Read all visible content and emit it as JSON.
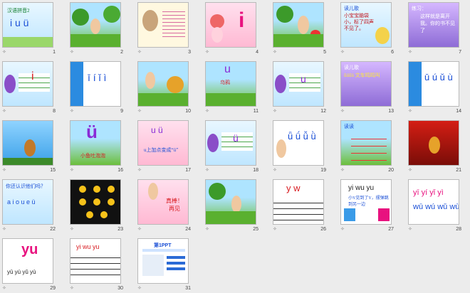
{
  "slides": [
    {
      "num": "1",
      "label": "汉语拼音2",
      "title": "i u ü"
    },
    {
      "num": "2"
    },
    {
      "num": "3"
    },
    {
      "num": "4",
      "label": "i"
    },
    {
      "num": "5"
    },
    {
      "num": "6",
      "label": "读儿歌",
      "text": "小宝宝脑袋小，标了四声不见了。"
    },
    {
      "num": "7",
      "label": "练习：",
      "text": "这样就是离开我。你的书不见了"
    },
    {
      "num": "8",
      "label": "i"
    },
    {
      "num": "9",
      "label": "ī í ǐ ì"
    },
    {
      "num": "10"
    },
    {
      "num": "11",
      "label": "u",
      "text": "乌鸦"
    },
    {
      "num": "12",
      "label": "u"
    },
    {
      "num": "13",
      "label": "读儿歌",
      "text": "ūúǔù 文车鸣鸣叫"
    },
    {
      "num": "14",
      "label": "ū ú ǔ ù"
    },
    {
      "num": "15"
    },
    {
      "num": "16",
      "label": "ü",
      "text": "小鱼吐泡泡"
    },
    {
      "num": "17",
      "label": "u  ü",
      "text": "u上加点变成“ü”"
    },
    {
      "num": "18",
      "label": "ü"
    },
    {
      "num": "19",
      "label": "ǖ ǘ ǚ ǜ"
    },
    {
      "num": "20",
      "label": "读读"
    },
    {
      "num": "21"
    },
    {
      "num": "22",
      "label": "你还认识他们吗？",
      "text": "a i o u e ü"
    },
    {
      "num": "23"
    },
    {
      "num": "24",
      "text": "真棒！再见"
    },
    {
      "num": "25"
    },
    {
      "num": "26",
      "text": "y   w"
    },
    {
      "num": "27",
      "label": "yi  wu  yu",
      "text": "小Y见到了Y，摆弹跳到另一边"
    },
    {
      "num": "28",
      "label": "yī yí yǐ yì",
      "text": "wū wú wǔ wù"
    },
    {
      "num": "29",
      "label": "yu",
      "text": "yū  yú  yǔ  yù"
    },
    {
      "num": "30",
      "text": "yi    wu    yu"
    },
    {
      "num": "31",
      "label": "第1PPT"
    }
  ],
  "colors": {
    "pink": "#e8127f",
    "red": "#d81b20",
    "blue": "#1a4fd6",
    "green": "#2a8f1d"
  }
}
